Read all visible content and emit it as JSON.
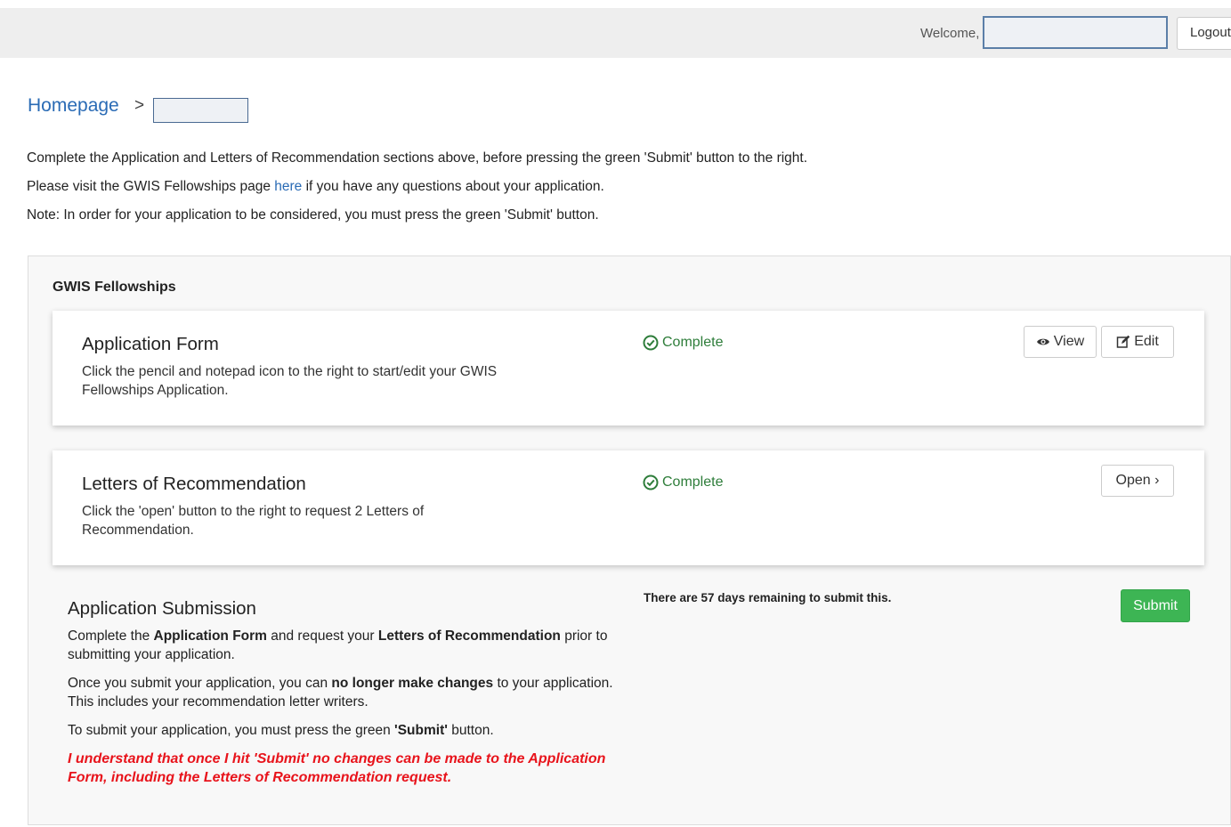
{
  "header": {
    "welcome_label": "Welcome,",
    "logout_label": "Logout"
  },
  "breadcrumb": {
    "home_label": "Homepage",
    "separator": ">"
  },
  "intro": {
    "line1": "Complete the Application and Letters of Recommendation sections above, before pressing the green 'Submit' button to the right.",
    "line2_before": "Please visit the GWIS Fellowships page ",
    "line2_link": "here",
    "line2_after": " if you have any questions about your application.",
    "line3": "Note: In order for your application to be considered, you must press the green 'Submit' button."
  },
  "panel": {
    "title": "GWIS Fellowships"
  },
  "application_form": {
    "title": "Application Form",
    "description": "Click the pencil and notepad icon to the right to start/edit your GWIS Fellowships Application.",
    "status": "Complete",
    "view_label": "View",
    "edit_label": "Edit"
  },
  "letters": {
    "title": "Letters of Recommendation",
    "description": "Click the 'open' button to the right to request 2 Letters of Recommendation.",
    "status": "Complete",
    "open_label": "Open ›"
  },
  "submission": {
    "title": "Application Submission",
    "p1_a": "Complete the ",
    "p1_b": "Application Form",
    "p1_c": " and request your ",
    "p1_d": "Letters of Recommendation",
    "p1_e": " prior to submitting your application.",
    "p2_a": "Once you submit your application, you can ",
    "p2_b": "no longer make changes",
    "p2_c": " to your application. This includes your recommendation letter writers.",
    "p3_a": "To submit your application, you must press the green ",
    "p3_b": "'Submit'",
    "p3_c": " button.",
    "warning": "I understand that once I hit 'Submit' no changes can be made to the Application Form, including the Letters of Recommendation request.",
    "remaining": "There are 57 days remaining to submit this.",
    "submit_label": "Submit"
  },
  "colors": {
    "link": "#2a6bb5",
    "complete": "#2e7d3a",
    "submit": "#3db554",
    "warning": "#e8131b"
  },
  "icons": {
    "complete": "check-circle-icon",
    "view": "eye-icon",
    "edit": "edit-icon"
  }
}
